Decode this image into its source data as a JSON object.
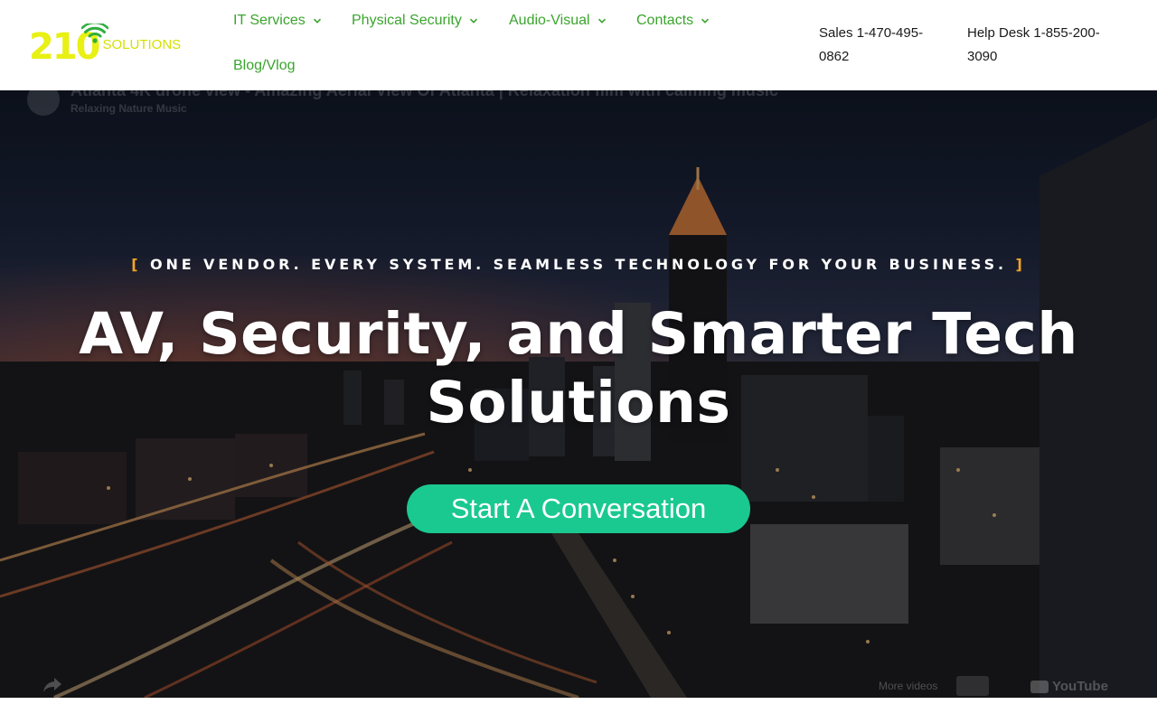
{
  "brand": {
    "logo_number": "210",
    "logo_word": "SOLUTIONS",
    "logo_color": "#e8f014",
    "wifi_color": "#2fae3d"
  },
  "nav": {
    "items": [
      {
        "label": "IT Services",
        "has_dropdown": true
      },
      {
        "label": "Physical Security",
        "has_dropdown": true
      },
      {
        "label": "Audio-Visual",
        "has_dropdown": true
      },
      {
        "label": "Contacts",
        "has_dropdown": true
      },
      {
        "label": "Blog/Vlog",
        "has_dropdown": false
      }
    ],
    "link_color": "#3aa52d"
  },
  "contacts": {
    "sales": "Sales 1-470-495-0862",
    "help_desk": "Help Desk 1-855-200-3090"
  },
  "video": {
    "title": "Atlanta 4K drone view - Amazing Aerial View Of Atlanta | Relaxation film with calming music",
    "channel": "Relaxing Nature Music",
    "more_videos": "More videos",
    "platform": "YouTube"
  },
  "hero": {
    "tagline_open": "[",
    "tagline": "ONE VENDOR. EVERY SYSTEM. SEAMLESS TECHNOLOGY FOR YOUR BUSINESS.",
    "tagline_close": "]",
    "headline": "AV, Security, and Smarter Tech Solutions",
    "cta_label": "Start A Conversation",
    "accent_color": "#f5a623",
    "cta_color": "#1ac98f"
  }
}
